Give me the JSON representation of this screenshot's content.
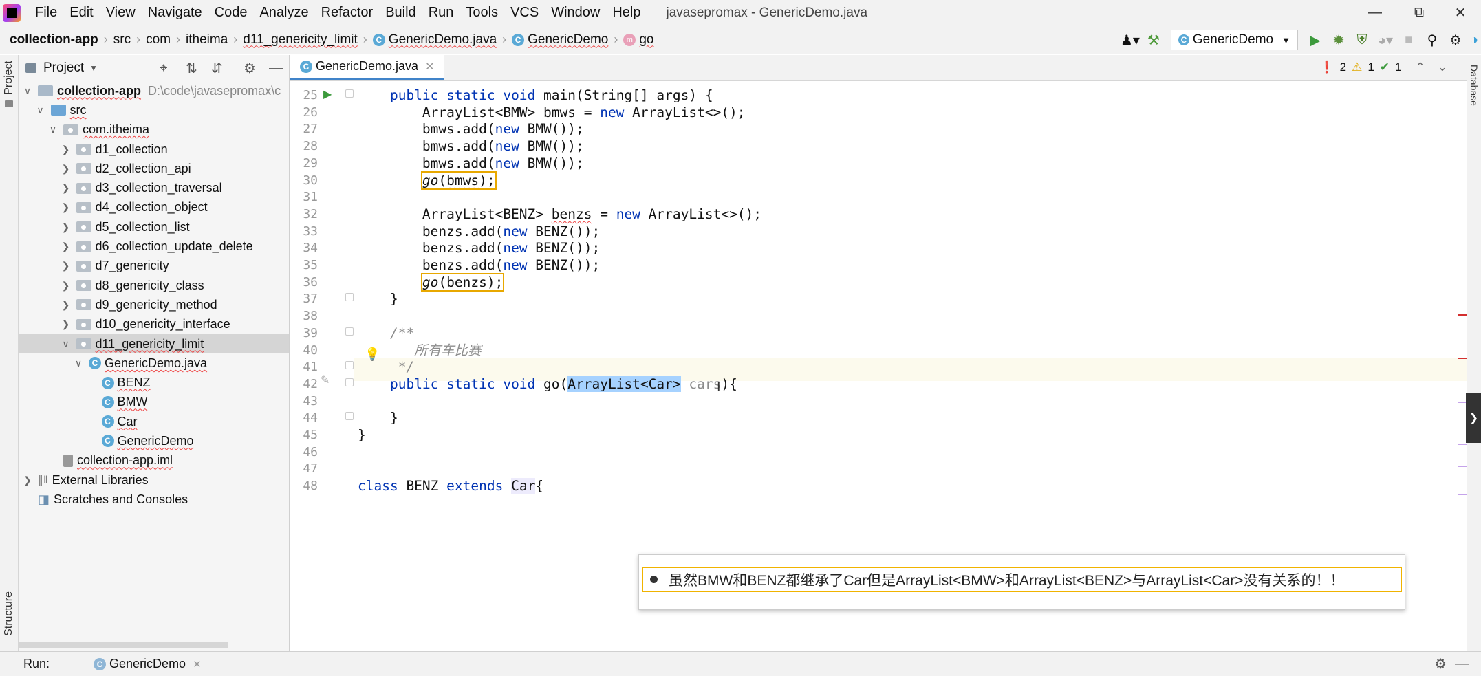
{
  "menubar": {
    "items": [
      "File",
      "Edit",
      "View",
      "Navigate",
      "Code",
      "Analyze",
      "Refactor",
      "Build",
      "Run",
      "Tools",
      "VCS",
      "Window",
      "Help"
    ],
    "title": "javasepromax - GenericDemo.java"
  },
  "breadcrumb": {
    "items": [
      "collection-app",
      "src",
      "com",
      "itheima",
      "d11_genericity_limit",
      "GenericDemo.java",
      "GenericDemo",
      "go"
    ]
  },
  "toolbar": {
    "run_config": "GenericDemo"
  },
  "sidebar": {
    "strip_top": "Project",
    "strip_bottom": "Structure"
  },
  "project": {
    "header": "Project",
    "tree": [
      {
        "label": "collection-app",
        "hint": "D:\\code\\javasepromax\\c",
        "indent": 0,
        "arrow": "v",
        "icon": "plain",
        "bold": true
      },
      {
        "label": "src",
        "indent": 1,
        "arrow": "v",
        "icon": "blue"
      },
      {
        "label": "com.itheima",
        "indent": 2,
        "arrow": "v",
        "icon": "pkg"
      },
      {
        "label": "d1_collection",
        "indent": 3,
        "arrow": ">",
        "icon": "pkg"
      },
      {
        "label": "d2_collection_api",
        "indent": 3,
        "arrow": ">",
        "icon": "pkg"
      },
      {
        "label": "d3_collection_traversal",
        "indent": 3,
        "arrow": ">",
        "icon": "pkg"
      },
      {
        "label": "d4_collection_object",
        "indent": 3,
        "arrow": ">",
        "icon": "pkg"
      },
      {
        "label": "d5_collection_list",
        "indent": 3,
        "arrow": ">",
        "icon": "pkg"
      },
      {
        "label": "d6_collection_update_delete",
        "indent": 3,
        "arrow": ">",
        "icon": "pkg"
      },
      {
        "label": "d7_genericity",
        "indent": 3,
        "arrow": ">",
        "icon": "pkg"
      },
      {
        "label": "d8_genericity_class",
        "indent": 3,
        "arrow": ">",
        "icon": "pkg"
      },
      {
        "label": "d9_genericity_method",
        "indent": 3,
        "arrow": ">",
        "icon": "pkg"
      },
      {
        "label": "d10_genericity_interface",
        "indent": 3,
        "arrow": ">",
        "icon": "pkg"
      },
      {
        "label": "d11_genericity_limit",
        "indent": 3,
        "arrow": "v",
        "icon": "pkg",
        "selected": true
      },
      {
        "label": "GenericDemo.java",
        "indent": 4,
        "arrow": "v",
        "icon": "class"
      },
      {
        "label": "BENZ",
        "indent": 5,
        "arrow": "",
        "icon": "class"
      },
      {
        "label": "BMW",
        "indent": 5,
        "arrow": "",
        "icon": "class"
      },
      {
        "label": "Car",
        "indent": 5,
        "arrow": "",
        "icon": "class"
      },
      {
        "label": "GenericDemo",
        "indent": 5,
        "arrow": "",
        "icon": "class"
      },
      {
        "label": "collection-app.iml",
        "indent": 2,
        "arrow": "",
        "icon": "iml"
      },
      {
        "label": "External Libraries",
        "indent": 0,
        "arrow": ">",
        "icon": "lib"
      },
      {
        "label": "Scratches and Consoles",
        "indent": 0,
        "arrow": "",
        "icon": "scratch"
      }
    ]
  },
  "editor": {
    "tab": "GenericDemo.java",
    "inspections": {
      "errors": "2",
      "warnings": "1",
      "ok": "1"
    },
    "lines": [
      {
        "n": "25",
        "html": "    <span class='kw'>public static void</span> main(String[] args) {"
      },
      {
        "n": "26",
        "html": "        ArrayList&lt;BMW&gt; bmws = <span class='kw'>new</span> ArrayList&lt;&gt;();"
      },
      {
        "n": "27",
        "html": "        bmws.add(<span class='kw'>new</span> BMW());"
      },
      {
        "n": "28",
        "html": "        bmws.add(<span class='kw'>new</span> BMW());"
      },
      {
        "n": "29",
        "html": "        bmws.add(<span class='kw'>new</span> BMW());"
      },
      {
        "n": "30",
        "html": "        <span class='box'><span class='it'>go</span>(<span class='squig'>bmws</span>);</span>"
      },
      {
        "n": "31",
        "html": ""
      },
      {
        "n": "32",
        "html": "        ArrayList&lt;BENZ&gt; <span class='squig'>benzs</span> = <span class='kw'>new</span> ArrayList&lt;&gt;();"
      },
      {
        "n": "33",
        "html": "        benzs.add(<span class='kw'>new</span> BENZ());"
      },
      {
        "n": "34",
        "html": "        benzs.add(<span class='kw'>new</span> BENZ());"
      },
      {
        "n": "35",
        "html": "        benzs.add(<span class='kw'>new</span> BENZ());"
      },
      {
        "n": "36",
        "html": "        <span class='box'><span class='it'>go</span>(benzs);</span>"
      },
      {
        "n": "37",
        "html": "    }"
      },
      {
        "n": "38",
        "html": ""
      },
      {
        "n": "39",
        "html": "    <span class='cm'>/**</span>"
      },
      {
        "n": "40",
        "html": "<span class='cm'>       所有车比赛</span>"
      },
      {
        "n": "41",
        "html": "<span class='cm'>     */</span>"
      },
      {
        "n": "42",
        "html": "    <span class='kw'>public static void</span> go(<span class='selh'>ArrayList&lt;Car&gt;</span> <span class='gray'>cars</span>){"
      },
      {
        "n": "43",
        "html": ""
      },
      {
        "n": "44",
        "html": "    }"
      },
      {
        "n": "45",
        "html": "}"
      },
      {
        "n": "46",
        "html": ""
      },
      {
        "n": "47",
        "html": ""
      },
      {
        "n": "48",
        "html": "<span class='kw'>class</span> BENZ <span class='kw'>extends</span> <span class='selh' style='background:#edebfc'>Car</span>{"
      }
    ]
  },
  "callout": {
    "text": "虽然BMW和BENZ都继承了Car但是ArrayList<BMW>和ArrayList<BENZ>与ArrayList<Car>没有关系的！！"
  },
  "bottom": {
    "run_label": "Run:",
    "run_tab": "GenericDemo"
  }
}
